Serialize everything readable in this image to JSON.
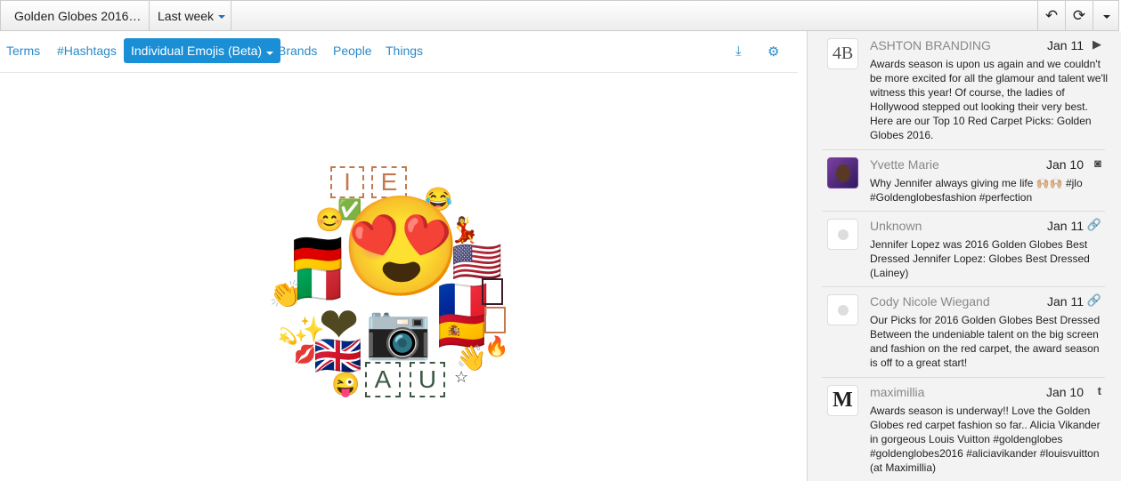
{
  "toolbar": {
    "title": "Golden Globes 2016…",
    "range": "Last week",
    "back_icon": "↶",
    "refresh_icon": "⟳"
  },
  "tabs": [
    "Terms",
    "#Hashtags",
    "Individual Emojis (Beta)",
    "Brands",
    "People",
    "Things"
  ],
  "active_tab": "Individual Emojis (Beta)",
  "tools": {
    "download_icon": "⤓",
    "settings_icon": "⚙"
  },
  "emoji_cloud": {
    "letters": [
      "I",
      "E",
      "A",
      "U"
    ],
    "emojis": {
      "main": "😍",
      "laugh": "😂",
      "check": "✅",
      "smile": "😊",
      "dancer": "💃",
      "germany": "🇩🇪",
      "usa": "🇺🇸",
      "italy": "🇮🇹",
      "france": "🇫🇷",
      "clap": "👏",
      "heart": "❤",
      "camera": "📷",
      "spain": "🇪🇸",
      "sparkles": "✨",
      "dizzy": "💫",
      "kiss": "💋",
      "uk": "🇬🇧",
      "wave": "👋",
      "fire": "🔥",
      "wink": "😜",
      "star": "☆"
    }
  },
  "posts": [
    {
      "author": "ASHTON BRANDING",
      "avatar": "4B",
      "date": "Jan 11",
      "network_icon": "▶",
      "text": "Awards season is upon us again and we couldn't be more excited for all the glamour and talent we'll witness this year! Of course, the ladies of Hollywood stepped out looking their very best. Here are our Top 10 Red Carpet Picks: Golden Globes 2016."
    },
    {
      "author": "Yvette Marie",
      "avatar": "",
      "date": "Jan 10",
      "network_icon": "◙",
      "text": "Why Jennifer always giving me life 🙌🏼🙌🏼 #jlo #Goldenglobesfashion #perfection"
    },
    {
      "author": "Unknown",
      "avatar": "",
      "date": "Jan 11",
      "network_icon": "🔗",
      "text": "Jennifer Lopez was 2016 Golden Globes Best Dressed Jennifer Lopez: Globes Best Dressed (Lainey)"
    },
    {
      "author": "Cody Nicole Wiegand",
      "avatar": "",
      "date": "Jan 11",
      "network_icon": "🔗",
      "text": "Our Picks for 2016 Golden Globes Best Dressed Between the undeniable talent on the big screen and fashion on the red carpet, the award season is off to a great start!"
    },
    {
      "author": "maximillia",
      "avatar": "M",
      "date": "Jan 10",
      "network_icon": "t",
      "text": "Awards season is underway!! Love the Golden Globes red carpet fashion so far.. Alicia Vikander in gorgeous Louis Vuitton #goldenglobes #goldenglobes2016 #aliciavikander #louisvuitton (at Maximillia)"
    }
  ]
}
